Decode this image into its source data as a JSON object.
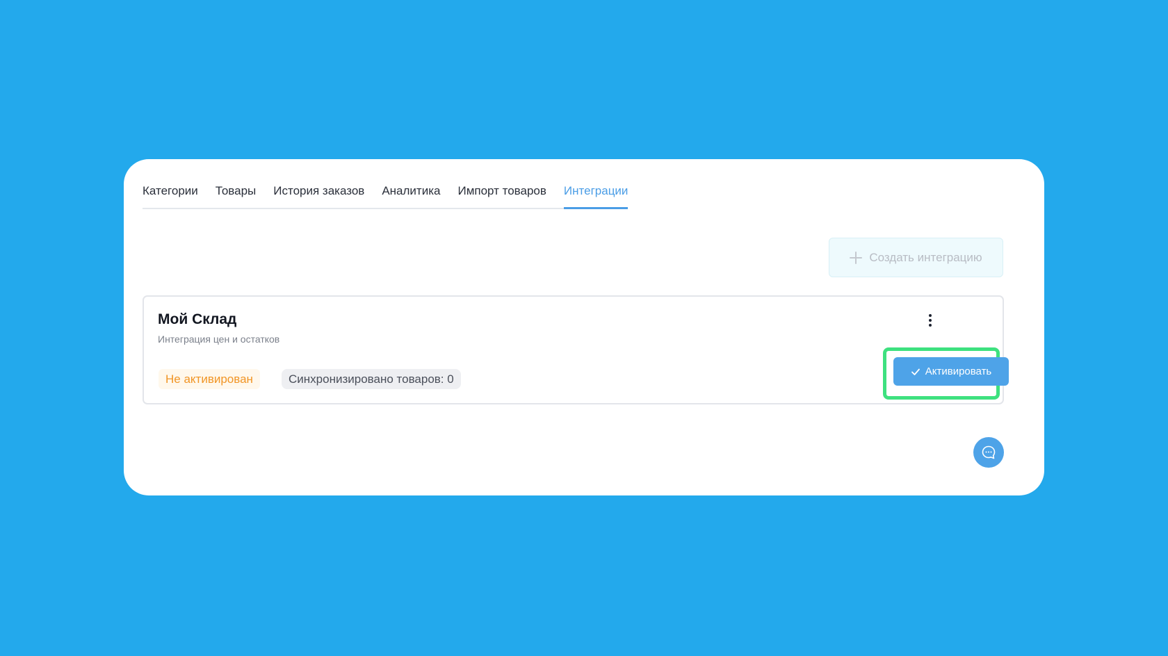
{
  "tabs": [
    {
      "label": "Категории",
      "active": false
    },
    {
      "label": "Товары",
      "active": false
    },
    {
      "label": "История заказов",
      "active": false
    },
    {
      "label": "Аналитика",
      "active": false
    },
    {
      "label": "Импорт товаров",
      "active": false
    },
    {
      "label": "Интеграции",
      "active": true
    }
  ],
  "toolbar": {
    "create_label": "Создать интеграцию",
    "create_icon": "plus-icon"
  },
  "integration": {
    "title": "Мой Склад",
    "subtitle": "Интеграция цен и остатков",
    "status_label": "Не активирован",
    "sync_label": "Синхронизировано товаров: 0",
    "menu_icon": "more-vertical-icon",
    "activate_label": "Активировать",
    "activate_icon": "check-icon"
  },
  "chat": {
    "icon": "chat-bubble-icon"
  },
  "colors": {
    "background": "#23a9ec",
    "accent": "#4ea3e8",
    "active_tab": "#4a9de6",
    "status_warning": "#f19525",
    "highlight": "#3ee17f"
  }
}
